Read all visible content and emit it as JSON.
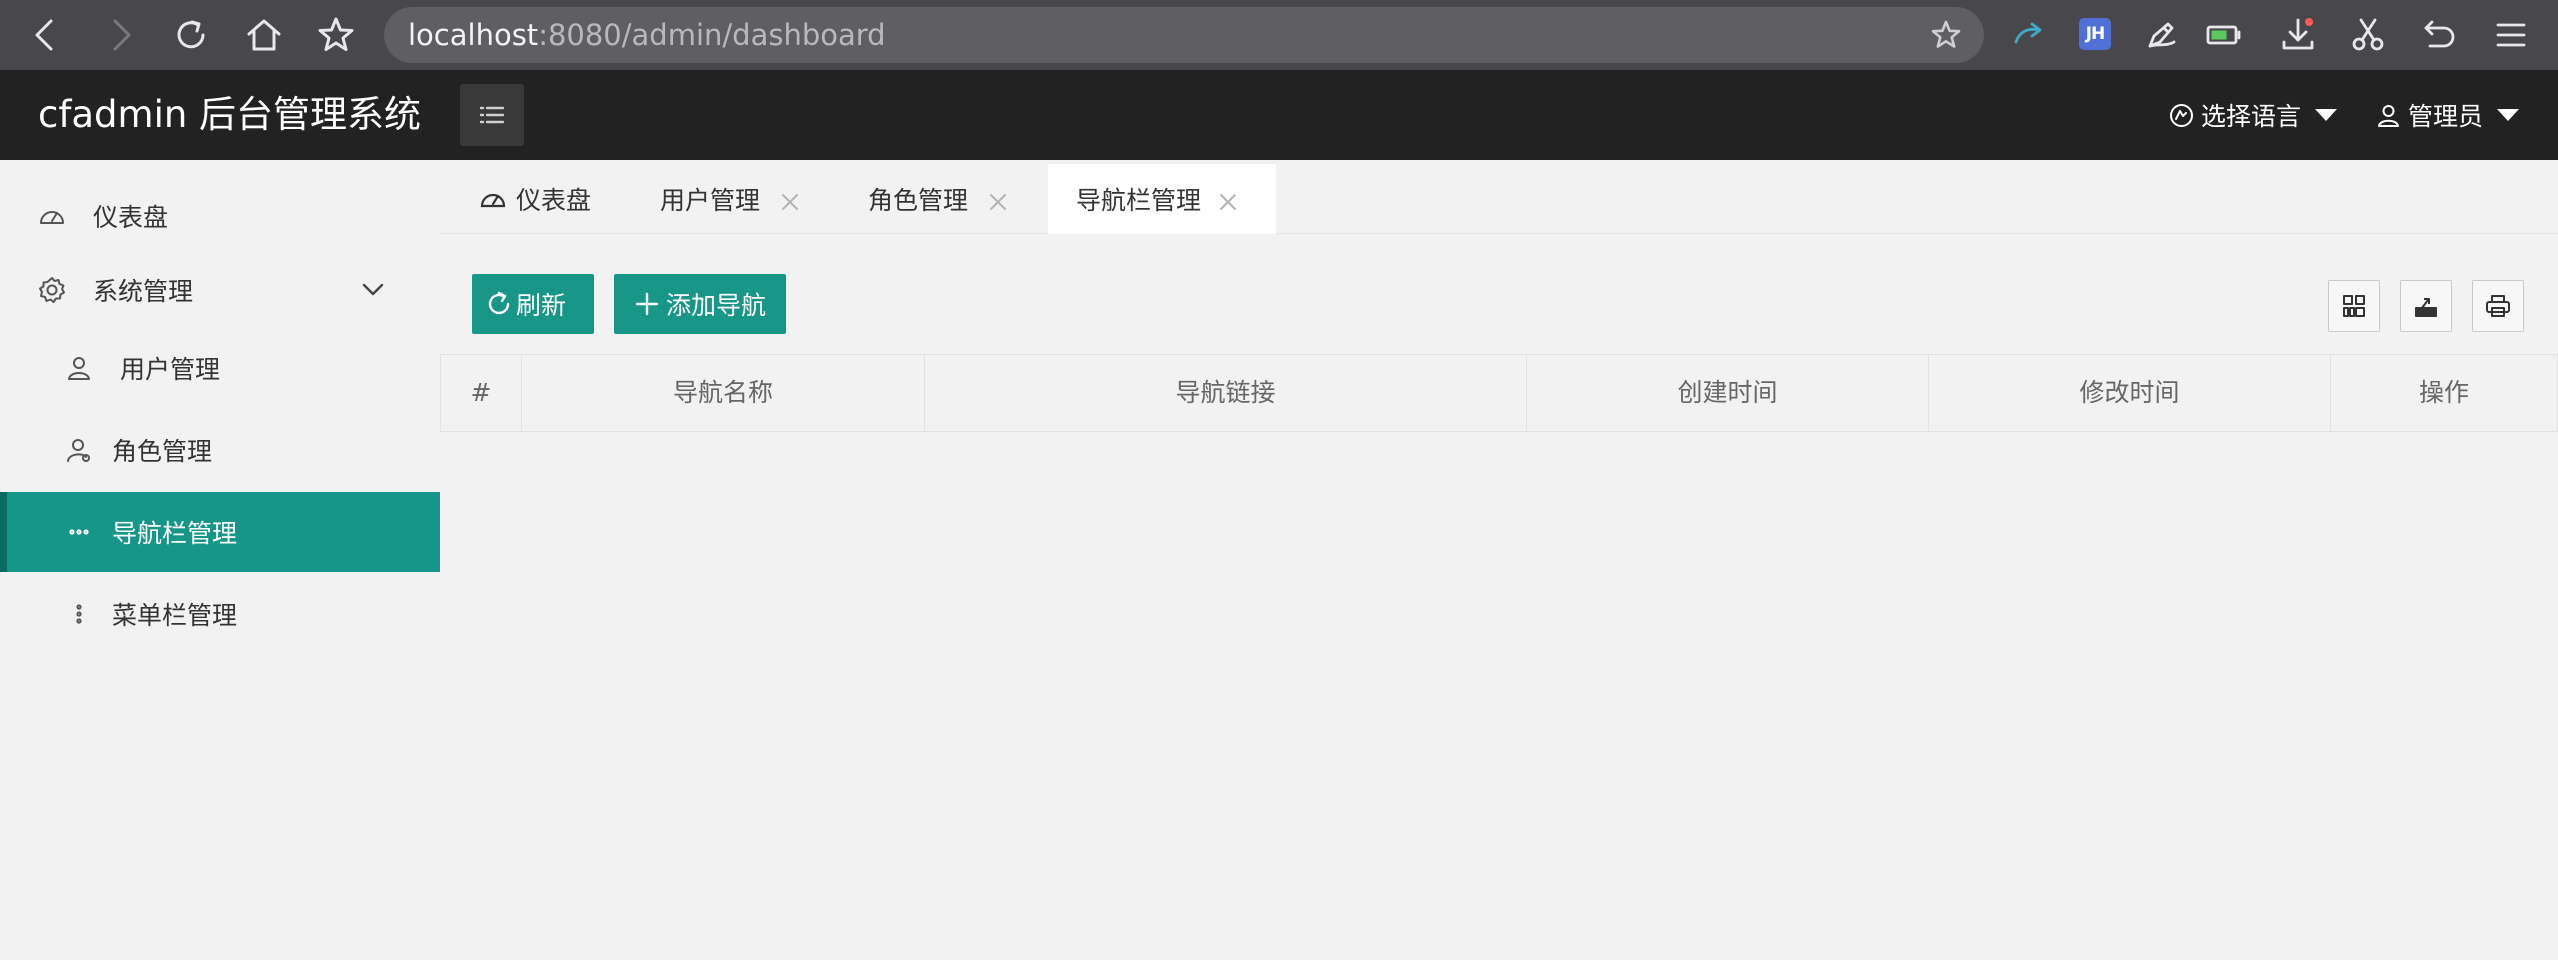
{
  "browser": {
    "url_host": "localhost",
    "url_rest": ":8080/admin/dashboard",
    "extension_jh_label": "JH"
  },
  "header": {
    "logo": "cfadmin 后台管理系统",
    "language_label": "选择语言",
    "user_label": "管理员"
  },
  "sidebar": {
    "items": [
      {
        "label": "仪表盘",
        "icon": "dashboard-icon"
      },
      {
        "label": "系统管理",
        "icon": "gear-icon"
      },
      {
        "label": "用户管理",
        "icon": "user-icon"
      },
      {
        "label": "角色管理",
        "icon": "role-icon"
      },
      {
        "label": "导航栏管理",
        "icon": "more-horizontal-icon",
        "active": true
      },
      {
        "label": "菜单栏管理",
        "icon": "more-vertical-icon"
      }
    ]
  },
  "tabs": [
    {
      "label": "仪表盘",
      "closable": false
    },
    {
      "label": "用户管理",
      "closable": true
    },
    {
      "label": "角色管理",
      "closable": true
    },
    {
      "label": "导航栏管理",
      "closable": true,
      "active": true
    }
  ],
  "toolbar": {
    "refresh_label": "刷新",
    "add_label": "添加导航"
  },
  "table": {
    "columns": [
      "#",
      "导航名称",
      "导航链接",
      "创建时间",
      "修改时间",
      "操作"
    ],
    "rows": []
  },
  "colors": {
    "accent": "#189688",
    "header_bg": "#222222",
    "browser_bg": "#48484c"
  }
}
